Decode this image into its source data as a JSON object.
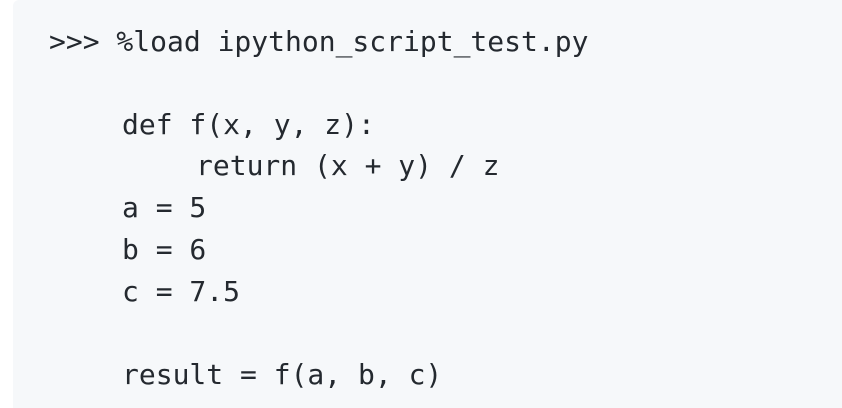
{
  "code": {
    "lines": [
      ">>> %load ipython_script_test.py",
      "def f(x, y, z):",
      "return (x + y) / z",
      "a = 5",
      "b = 6",
      "c = 7.5",
      "result = f(a, b, c)"
    ]
  }
}
